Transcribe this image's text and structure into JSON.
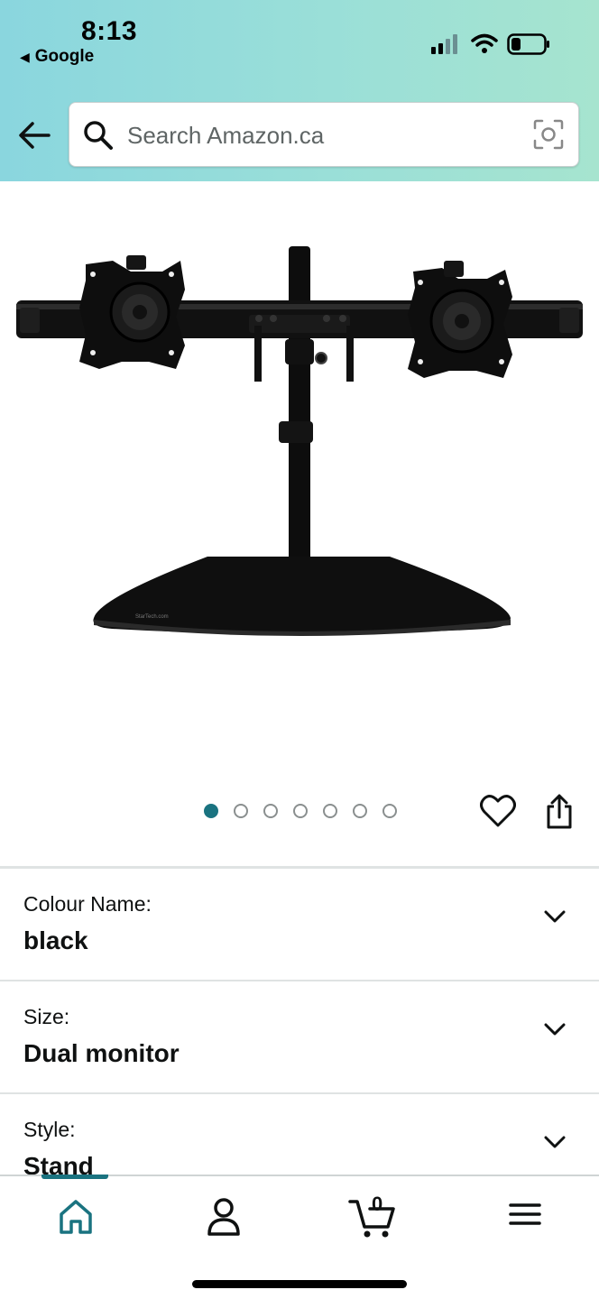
{
  "status_bar": {
    "time": "8:13",
    "back_app": "Google"
  },
  "search": {
    "placeholder": "Search Amazon.ca"
  },
  "gallery": {
    "image_count": 7,
    "active_index": 0,
    "brand_mark": "StarTech.com"
  },
  "options": [
    {
      "label": "Colour Name:",
      "value": "black"
    },
    {
      "label": "Size:",
      "value": "Dual monitor"
    },
    {
      "label": "Style:",
      "value": "Stand"
    }
  ],
  "bottom_nav": {
    "cart_count": "0",
    "active": "home"
  },
  "colors": {
    "accent": "#1a7380",
    "header_start": "#8ad6de",
    "header_end": "#a6e4cf"
  }
}
